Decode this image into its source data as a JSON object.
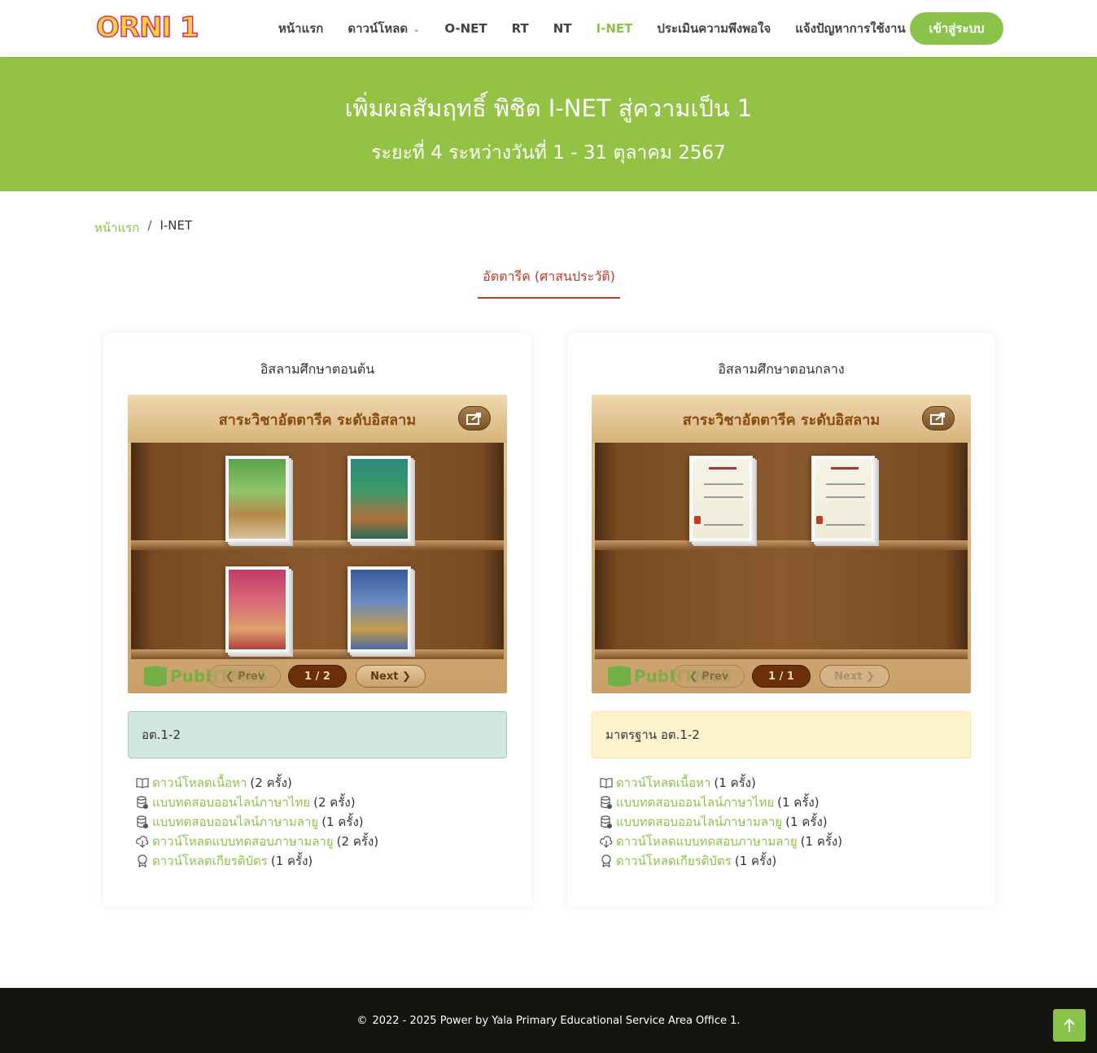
{
  "header": {
    "logo_text": "ORNI 1",
    "nav": [
      {
        "label": "หน้าแรก",
        "active": false
      },
      {
        "label": "ดาวน์โหลด",
        "active": false,
        "dropdown": true
      },
      {
        "label": "O-NET",
        "active": false
      },
      {
        "label": "RT",
        "active": false
      },
      {
        "label": "NT",
        "active": false
      },
      {
        "label": "I-NET",
        "active": true
      },
      {
        "label": "ประเมินความพึงพอใจ",
        "active": false
      },
      {
        "label": "แจ้งปัญหาการใช้งาน",
        "active": false
      }
    ],
    "login_label": "เข้าสู่ระบบ"
  },
  "hero": {
    "title": "เพิ่มผลสัมฤทธิ์ พิชิต I-NET สู่ความเป็น 1",
    "subtitle": "ระยะที่ 4  ระหว่างวันที่ 1 - 31 ตุลาคม 2567"
  },
  "breadcrumb": {
    "home": "หน้าแรก",
    "sep": "/",
    "current": "I-NET"
  },
  "tab": {
    "label": "อัตตารีค (ศาสนประวัติ)"
  },
  "cards": [
    {
      "title": "อิสลามศึกษาตอนต้น",
      "shelf_title": "สาระวิชาอัตตารีค ระดับอิสลาม",
      "pub_logo": "PubHTML5",
      "prev_label": "Prev",
      "page": "1 / 2",
      "next_label": "Next",
      "alert": "อต.1-2",
      "links": [
        {
          "icon": "book-open-icon",
          "label": "ดาวน์โหลดเนื้อหา",
          "count": "(2 ครั้ง)"
        },
        {
          "icon": "database-check-icon",
          "label": "แบบทดสอบออนไลน์ภาษาไทย",
          "count": "(2 ครั้ง)"
        },
        {
          "icon": "database-check-icon",
          "label": "แบบทดสอบออนไลน์ภาษามลายู",
          "count": "(1 ครั้ง)"
        },
        {
          "icon": "cloud-download-icon",
          "label": "ดาวน์โหลดแบบทดสอบภาษามลายู",
          "count": "(2 ครั้ง)"
        },
        {
          "icon": "award-icon",
          "label": "ดาวน์โหลดเกียรติบัตร",
          "count": "(1 ครั้ง)"
        }
      ]
    },
    {
      "title": "อิสลามศึกษาตอนกลาง",
      "shelf_title": "สาระวิชาอัตตารีค ระดับอิสลาม",
      "pub_logo": "PubHTML5",
      "prev_label": "Prev",
      "page": "1 / 1",
      "next_label": "Next",
      "alert": "มาตรฐาน อต.1-2",
      "links": [
        {
          "icon": "book-open-icon",
          "label": "ดาวน์โหลดเนื้อหา",
          "count": "(1 ครั้ง)"
        },
        {
          "icon": "database-check-icon",
          "label": "แบบทดสอบออนไลน์ภาษาไทย",
          "count": "(1 ครั้ง)"
        },
        {
          "icon": "database-check-icon",
          "label": "แบบทดสอบออนไลน์ภาษามลายู",
          "count": "(1 ครั้ง)"
        },
        {
          "icon": "cloud-download-icon",
          "label": "ดาวน์โหลดแบบทดสอบภาษามลายู",
          "count": "(1 ครั้ง)"
        },
        {
          "icon": "award-icon",
          "label": "ดาวน์โหลดเกียรติบัตร",
          "count": "(1 ครั้ง)"
        }
      ]
    }
  ],
  "footer": {
    "copyright_icon": "copyright-icon",
    "text": "2022 - 2025 Power by Yala Primary Educational Service Area Office 1."
  },
  "colors": {
    "accent": "#8bc34a",
    "hero_bg": "#94c245",
    "tab_red": "#c0392b",
    "footer_bg": "#141510"
  }
}
